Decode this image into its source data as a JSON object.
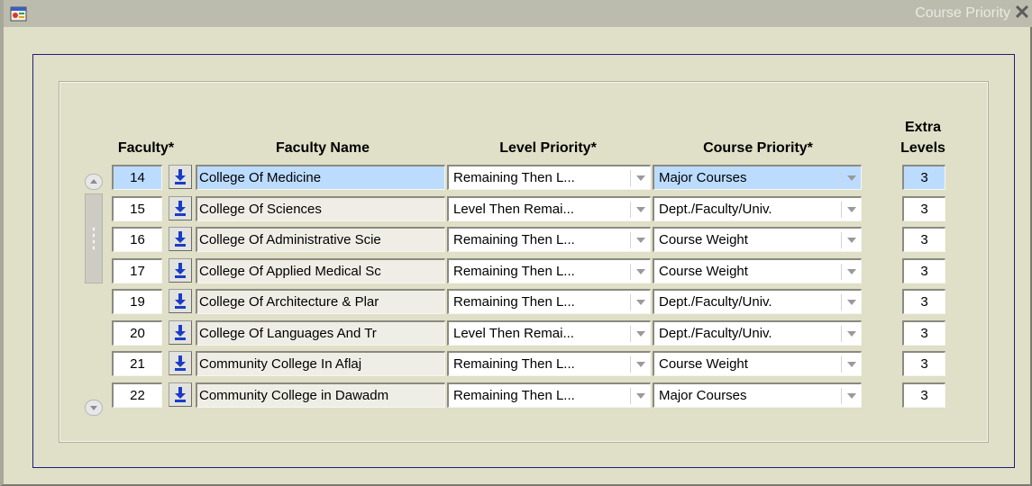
{
  "window": {
    "title": "Course Priority",
    "close_glyph": "✕",
    "app_icon": "app-icon",
    "close_icon": "close-icon"
  },
  "headers": {
    "faculty": "Faculty*",
    "faculty_name": "Faculty Name",
    "level_priority": "Level Priority*",
    "course_priority": "Course Priority*",
    "extra_levels_line1": "Extra",
    "extra_levels_line2": "Levels"
  },
  "rows": [
    {
      "faculty": "14",
      "name": "College Of Medicine",
      "level_priority": "Remaining Then L...",
      "course_priority": "Major Courses",
      "extra_levels": "3"
    },
    {
      "faculty": "15",
      "name": "College Of Sciences",
      "level_priority": "Level Then Remai...",
      "course_priority": "Dept./Faculty/Univ.",
      "extra_levels": "3"
    },
    {
      "faculty": "16",
      "name": "College Of Administrative Scie",
      "level_priority": "Remaining Then L...",
      "course_priority": "Course Weight",
      "extra_levels": "3"
    },
    {
      "faculty": "17",
      "name": "College Of Applied Medical Sc",
      "level_priority": "Remaining Then L...",
      "course_priority": "Course Weight",
      "extra_levels": "3"
    },
    {
      "faculty": "19",
      "name": "College Of Architecture & Plar",
      "level_priority": "Remaining Then L...",
      "course_priority": "Dept./Faculty/Univ.",
      "extra_levels": "3"
    },
    {
      "faculty": "20",
      "name": "College Of Languages And Tr",
      "level_priority": "Level Then Remai...",
      "course_priority": "Dept./Faculty/Univ.",
      "extra_levels": "3"
    },
    {
      "faculty": "21",
      "name": "Community College In Aflaj",
      "level_priority": "Remaining Then L...",
      "course_priority": "Course Weight",
      "extra_levels": "3"
    },
    {
      "faculty": "22",
      "name": "Community College in Dawadm",
      "level_priority": "Remaining Then L...",
      "course_priority": "Major Courses",
      "extra_levels": "3"
    }
  ],
  "current_record_index": 0,
  "icons": {
    "lov_button": "download-arrow-icon",
    "dropdown": "chevron-down-icon",
    "scroll_up": "scroll-up-icon",
    "scroll_down": "scroll-down-icon"
  },
  "colors": {
    "window_bg": "#e0dfc7",
    "titlebar": "#bcbcae",
    "frame_border": "#1e1e7a",
    "current_record": "#bcdcff",
    "lov_arrow": "#1a3cc8"
  }
}
